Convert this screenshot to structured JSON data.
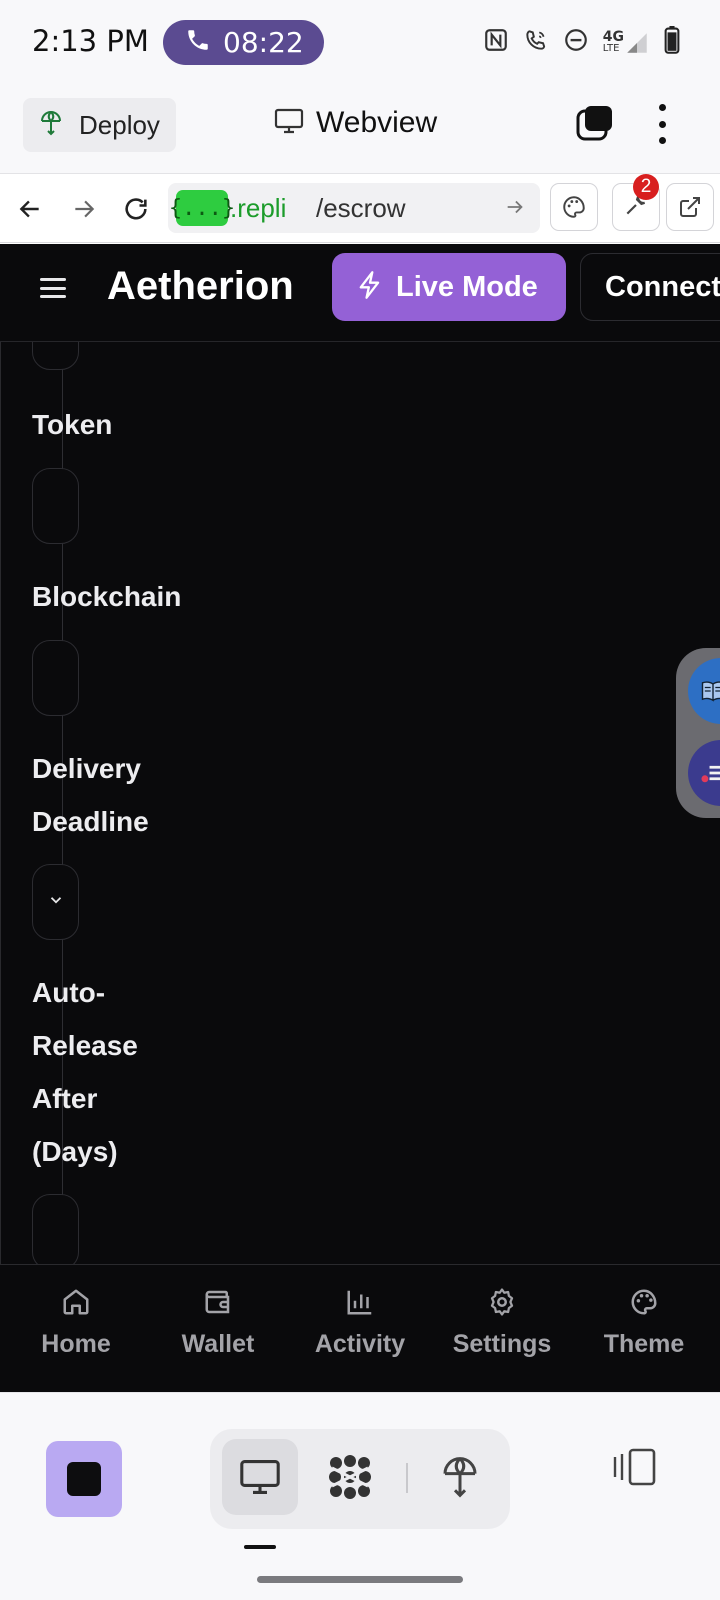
{
  "status_bar": {
    "time": "2:13 PM",
    "call_timer": "08:22",
    "icons": [
      "nfc-icon",
      "wifi-calling-icon",
      "do-not-disturb-icon",
      "signal-4g-lte-icon",
      "battery-icon"
    ],
    "network": "4G",
    "network_sub": "LTE"
  },
  "replit_top": {
    "deploy_label": "Deploy",
    "title": "Webview"
  },
  "url_bar": {
    "badge": "{...}",
    "host": ".repli",
    "path": "/escrow",
    "notification_count": "2"
  },
  "app": {
    "brand": "Aetherion",
    "live_mode_label": "Live Mode",
    "connect_label": "Connect",
    "accent": "#9461d6",
    "background": "#0a0a0c"
  },
  "form": {
    "fields": [
      {
        "label": "Token"
      },
      {
        "label": "Blockchain"
      },
      {
        "label_lines": [
          "Delivery",
          "Deadline"
        ]
      },
      {
        "label_lines": [
          "Auto-",
          "Release",
          "After",
          "(Days)"
        ]
      }
    ]
  },
  "bottom_nav": {
    "items": [
      {
        "label": "Home",
        "icon": "home-icon"
      },
      {
        "label": "Wallet",
        "icon": "wallet-icon"
      },
      {
        "label": "Activity",
        "icon": "bar-chart-icon"
      },
      {
        "label": "Settings",
        "icon": "gear-icon"
      },
      {
        "label": "Theme",
        "icon": "palette-icon"
      }
    ]
  },
  "replit_bottom": {
    "icons": [
      "stop-icon",
      "desktop-icon",
      "agent-icon",
      "deploy-icon",
      "side-panel-icon"
    ]
  }
}
